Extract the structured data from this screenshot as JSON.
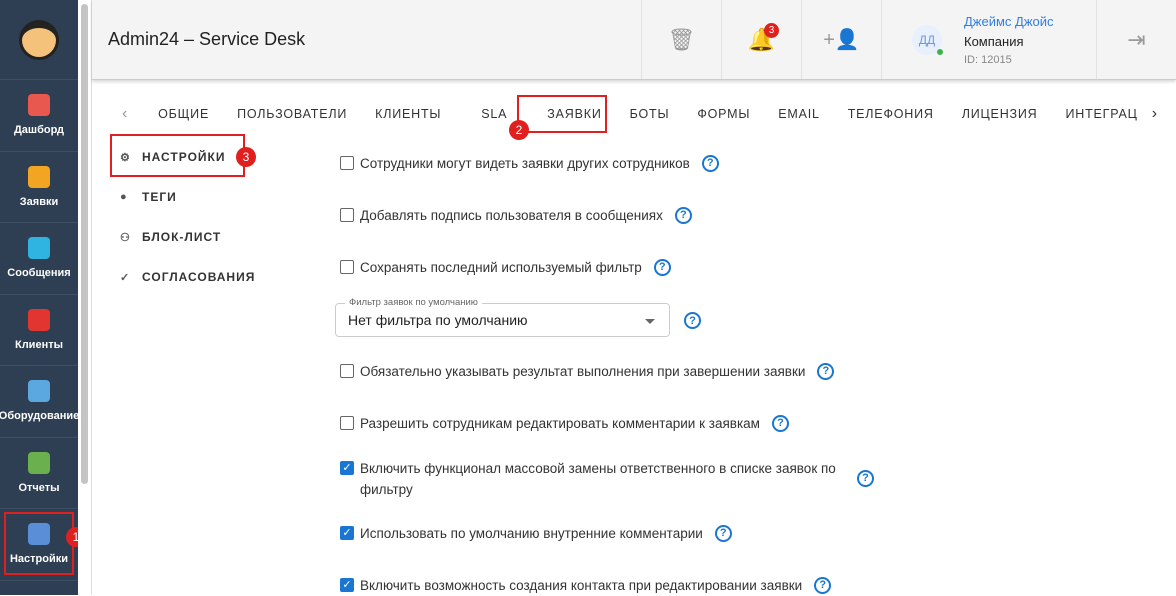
{
  "sidebar": {
    "items": [
      {
        "label": "Дашборд",
        "color": "#e9584f"
      },
      {
        "label": "Заявки",
        "color": "#f2a423"
      },
      {
        "label": "Сообщения",
        "color": "#2fb3e0"
      },
      {
        "label": "Клиенты",
        "color": "#e0362f"
      },
      {
        "label": "Оборудование",
        "color": "#5ba8e0"
      },
      {
        "label": "Отчеты",
        "color": "#6ab04c"
      },
      {
        "label": "Настройки",
        "color": "#5a8fd8"
      }
    ]
  },
  "header": {
    "title": "Admin24 – Service Desk",
    "notif_count": "3",
    "user_initials": "ДД",
    "user_name": "Джеймс Джойс",
    "company": "Компания",
    "user_id": "ID: 12015"
  },
  "tabs": [
    "ОБЩИЕ",
    "ПОЛЬЗОВАТЕЛИ",
    "КЛИЕНТЫ",
    "SLA",
    "ЗАЯВКИ",
    "БОТЫ",
    "ФОРМЫ",
    "EMAIL",
    "ТЕЛЕФОНИЯ",
    "ЛИЦЕНЗИЯ",
    "ИНТЕГРАЦ"
  ],
  "subnav": [
    "НАСТРОЙКИ",
    "ТЕГИ",
    "БЛОК-ЛИСТ",
    "СОГЛАСОВАНИЯ"
  ],
  "settings": [
    {
      "label": "Сотрудники могут видеть заявки других сотрудников",
      "checked": false
    },
    {
      "label": "Добавлять подпись пользователя в сообщениях",
      "checked": false
    },
    {
      "label": "Сохранять последний используемый фильтр",
      "checked": false
    },
    {
      "label": "Обязательно указывать результат выполнения при завершении заявки",
      "checked": false
    },
    {
      "label": "Разрешить сотрудникам редактировать комментарии к заявкам",
      "checked": false
    },
    {
      "label": "Включить функционал массовой замены ответственного в списке заявок по фильтру",
      "checked": true
    },
    {
      "label": "Использовать по умолчанию внутренние комментарии",
      "checked": true
    },
    {
      "label": "Включить возможность создания контакта при редактировании заявки",
      "checked": true
    }
  ],
  "filter": {
    "label": "Фильтр заявок по умолчанию",
    "value": "Нет фильтра по умолчанию"
  },
  "annotations": [
    "1",
    "2",
    "3"
  ],
  "help": "?"
}
